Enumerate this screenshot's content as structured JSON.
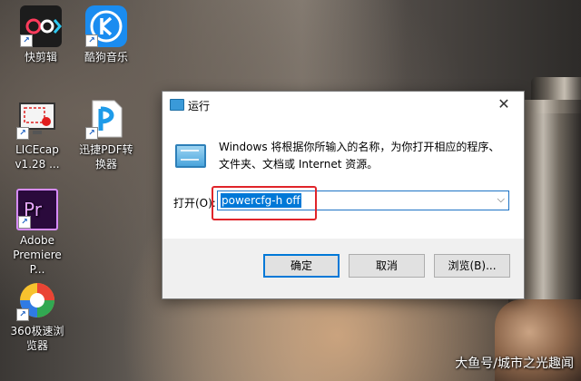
{
  "desktop": {
    "icons": [
      {
        "label": "快剪辑",
        "icon": "kuaijianji-app-icon"
      },
      {
        "label": "酷狗音乐",
        "icon": "kugou-music-icon"
      },
      {
        "label": "LICEcap v1.28 ...",
        "icon": "licecap-icon"
      },
      {
        "label": "迅捷PDF转换器",
        "icon": "xunjie-pdf-icon"
      },
      {
        "label": "Adobe Premiere P...",
        "icon": "premiere-pro-icon"
      },
      {
        "label": "360极速浏览器",
        "icon": "360-browser-icon"
      }
    ]
  },
  "dialog": {
    "title": "运行",
    "close": "✕",
    "description": "Windows 将根据你所输入的名称，为你打开相应的程序、文件夹、文档或 Internet 资源。",
    "open_label": "打开(O):",
    "input_value": "powercfg-h off",
    "buttons": {
      "ok": "确定",
      "cancel": "取消",
      "browse": "浏览(B)..."
    }
  },
  "watermark": "大鱼号/城市之光趣闻",
  "colors": {
    "highlight": "#e0242a",
    "selection": "#0078d7"
  }
}
